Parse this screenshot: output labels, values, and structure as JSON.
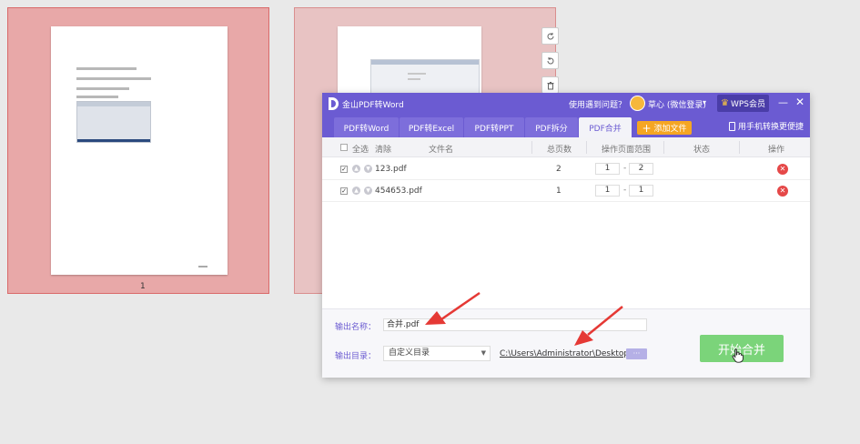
{
  "background": {
    "page_number": "1"
  },
  "tools": {
    "icons": [
      "rotate-right-icon",
      "rotate-left-icon",
      "trash-icon"
    ]
  },
  "app": {
    "title": "金山PDF转Word",
    "help": "使用遇到问题？",
    "user": "草心 (微信登录)",
    "user_caret": "▾",
    "vip": "WPS会员",
    "minimize": "—",
    "close": "✕"
  },
  "tabs": [
    {
      "label": "PDF转Word"
    },
    {
      "label": "PDF转Excel"
    },
    {
      "label": "PDF转PPT"
    },
    {
      "label": "PDF拆分"
    },
    {
      "label": "PDF合并"
    }
  ],
  "toolbar": {
    "add_file": "添加文件",
    "phone": "用手机转换更便捷"
  },
  "table": {
    "select_all": "全选",
    "clear": "清除",
    "col_filename": "文件名",
    "col_pages": "总页数",
    "col_range": "操作页面范围",
    "col_status": "状态",
    "col_action": "操作",
    "rows": [
      {
        "checked": "✓",
        "name": "123.pdf",
        "pages": "2",
        "from": "1",
        "to": "2"
      },
      {
        "checked": "✓",
        "name": "454653.pdf",
        "pages": "1",
        "from": "1",
        "to": "1"
      }
    ],
    "range_sep": "-",
    "delete": "✕"
  },
  "output": {
    "name_label": "输出名称：",
    "name_value": "合并.pdf",
    "dir_label": "输出目录：",
    "dir_option": "自定义目录",
    "dir_path": "C:\\Users\\Administrator\\Desktop\\",
    "browse": "···",
    "start": "开始合并"
  },
  "colors": {
    "accent": "#6b5bd2",
    "add_button": "#f5a623",
    "start_button": "#7bd47a",
    "delete": "#e54848",
    "annotation_arrow": "#e53935"
  }
}
